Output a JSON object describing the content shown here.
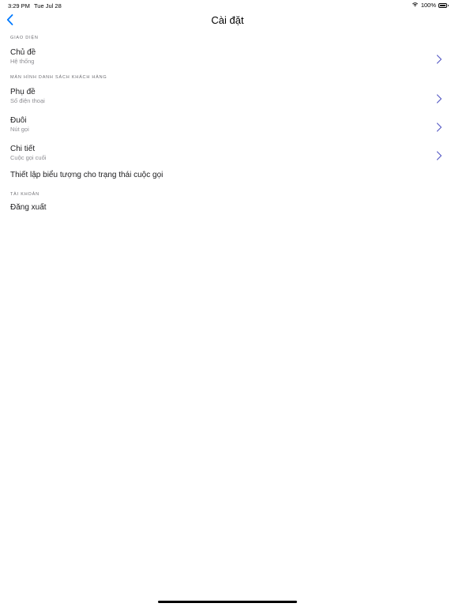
{
  "status_bar": {
    "time": "3:29 PM",
    "date": "Tue Jul 28",
    "battery": "100%",
    "battery_level": 1.0
  },
  "nav": {
    "title": "Cài đặt",
    "back_icon": "chevron-left-icon"
  },
  "colors": {
    "accent": "#007aff",
    "chevron": "#5b5fc7",
    "section_header": "#6d6d72",
    "subtitle": "#8e8e93"
  },
  "sections": {
    "interface": {
      "header": "GIAO DIỆN",
      "items": [
        {
          "title": "Chủ đề",
          "subtitle": "Hệ thống"
        }
      ]
    },
    "customer_list": {
      "header": "MÀN HÌNH DANH SÁCH KHÁCH HÀNG",
      "items": [
        {
          "title": "Phụ đề",
          "subtitle": "Số điện thoại"
        },
        {
          "title": "Đuôi",
          "subtitle": "Nút gọi"
        },
        {
          "title": "Chi tiết",
          "subtitle": "Cuộc gọi cuối"
        },
        {
          "title": "Thiết lập biểu tượng cho trạng thái cuộc gọi"
        }
      ]
    },
    "account": {
      "header": "TÀI KHOẢN",
      "items": [
        {
          "title": "Đăng xuất"
        }
      ]
    }
  }
}
